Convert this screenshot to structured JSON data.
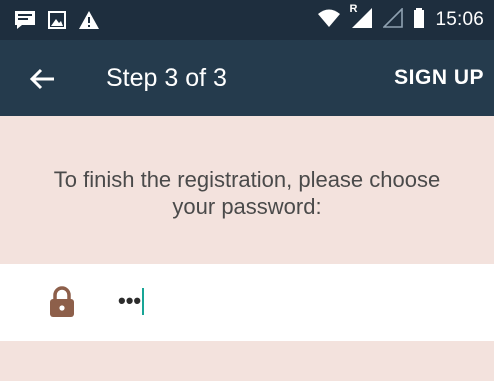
{
  "status_bar": {
    "time": "15:06",
    "icons": [
      "message-icon",
      "image-icon",
      "warning-icon",
      "wifi-icon",
      "signal-roaming-icon",
      "signal-empty-icon",
      "battery-icon"
    ],
    "roaming_label": "R"
  },
  "app_bar": {
    "title": "Step 3 of 3",
    "action": "SIGN UP",
    "back_icon": "arrow-back-icon"
  },
  "instruction": {
    "text_line1": "To finish the registration, please choose",
    "text_line2": "your password:"
  },
  "password": {
    "value": "•••",
    "icon": "lock-icon"
  },
  "colors": {
    "status_bar_bg": "#1e2e3e",
    "app_bar_bg": "#253b4d",
    "panel_bg": "#f3e2dd",
    "lock": "#8d5f4a",
    "cursor": "#18a596"
  }
}
